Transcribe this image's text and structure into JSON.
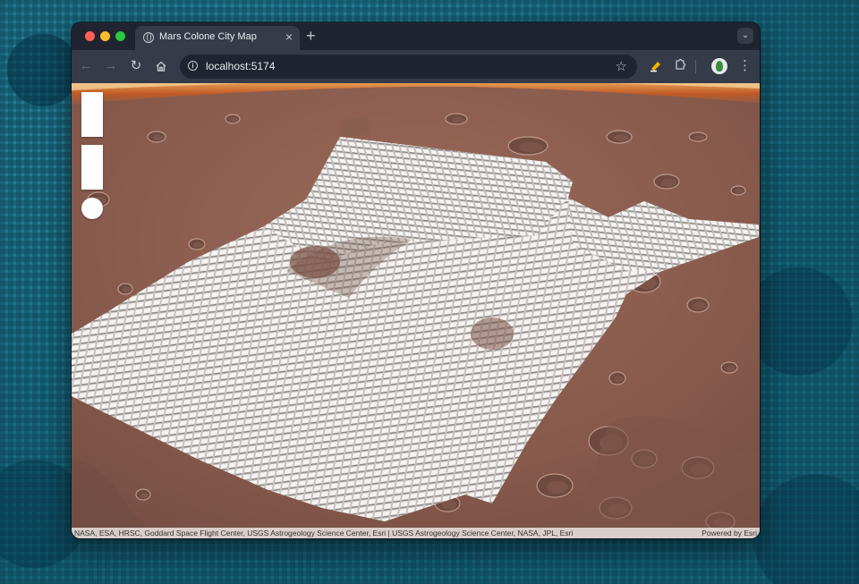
{
  "browser": {
    "tab_title": "Mars Colone City Map",
    "tab_close_glyph": "×",
    "new_tab_glyph": "+",
    "tab_menu_glyph": "⌄",
    "url": "localhost:5174",
    "icons": [
      "back-icon",
      "forward-icon",
      "reload-icon",
      "home-icon",
      "info-icon",
      "star-icon",
      "extension-pen-icon",
      "puzzle-icon",
      "profile-avatar",
      "kebab-menu-icon"
    ]
  },
  "map": {
    "controls": [
      "zoom-control-top",
      "zoom-control-bottom",
      "compass-button"
    ],
    "attribution": "NASA, ESA, HRSC, Goddard Space Flight Center, USGS Astrogeology Science Center, Esri | USGS Astrogeology Science Center, NASA, JPL, Esri",
    "powered_by": "Powered by Esri"
  },
  "colors": {
    "terrain": "#8a5f50",
    "buildings": "#f2f0ee",
    "horizon_glow": "#e07a2a"
  }
}
